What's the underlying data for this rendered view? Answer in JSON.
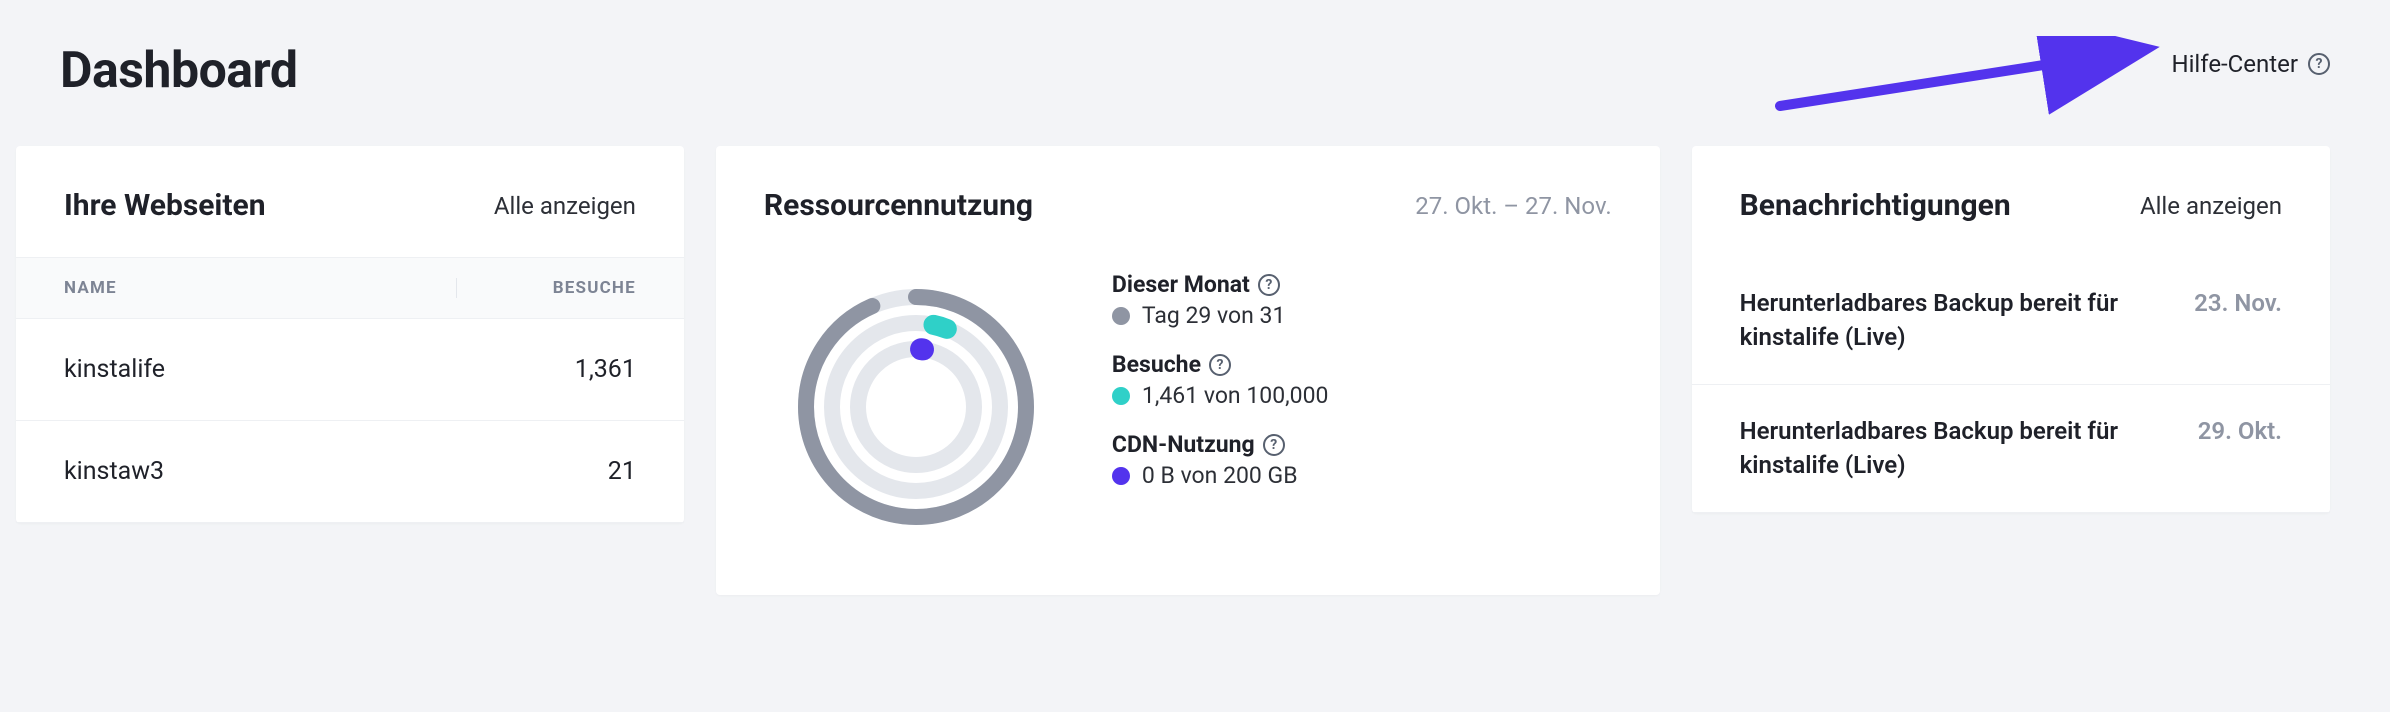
{
  "page": {
    "title": "Dashboard"
  },
  "help": {
    "label": "Hilfe-Center"
  },
  "colors": {
    "accent_purple": "#5333ed",
    "accent_teal": "#2fd0c8",
    "gray": "#8f95a3"
  },
  "sites_card": {
    "title": "Ihre Webseiten",
    "show_all": "Alle anzeigen",
    "columns": {
      "name": "NAME",
      "visits": "BESUCHE"
    },
    "rows": [
      {
        "name": "kinstalife",
        "visits": "1,361"
      },
      {
        "name": "kinstaw3",
        "visits": "21"
      }
    ]
  },
  "resources_card": {
    "title": "Ressourcennutzung",
    "date_range": "27. Okt. – 27. Nov.",
    "legend": {
      "month_title": "Dieser Monat",
      "month_value": "Tag 29 von 31",
      "visits_title": "Besuche",
      "visits_value": "1,461 von 100,000",
      "cdn_title": "CDN-Nutzung",
      "cdn_value": "0 B von 200 GB"
    }
  },
  "chart_data": {
    "type": "other",
    "kind": "concentric-rings",
    "title": "Ressourcennutzung",
    "series": [
      {
        "name": "Dieser Monat",
        "value": 29,
        "max": 31,
        "unit": "Tag",
        "color": "#8f95a3"
      },
      {
        "name": "Besuche",
        "value": 1461,
        "max": 100000,
        "unit": "",
        "color": "#2fd0c8"
      },
      {
        "name": "CDN-Nutzung",
        "value": 0,
        "max": 200,
        "unit": "GB",
        "color": "#5333ed"
      }
    ]
  },
  "notifications_card": {
    "title": "Benachrichtigungen",
    "show_all": "Alle anzeigen",
    "items": [
      {
        "text": "Herunterladbares Backup bereit für kinstalife (Live)",
        "date": "23. Nov."
      },
      {
        "text": "Herunterladbares Backup bereit für kinstalife (Live)",
        "date": "29. Okt."
      }
    ]
  }
}
